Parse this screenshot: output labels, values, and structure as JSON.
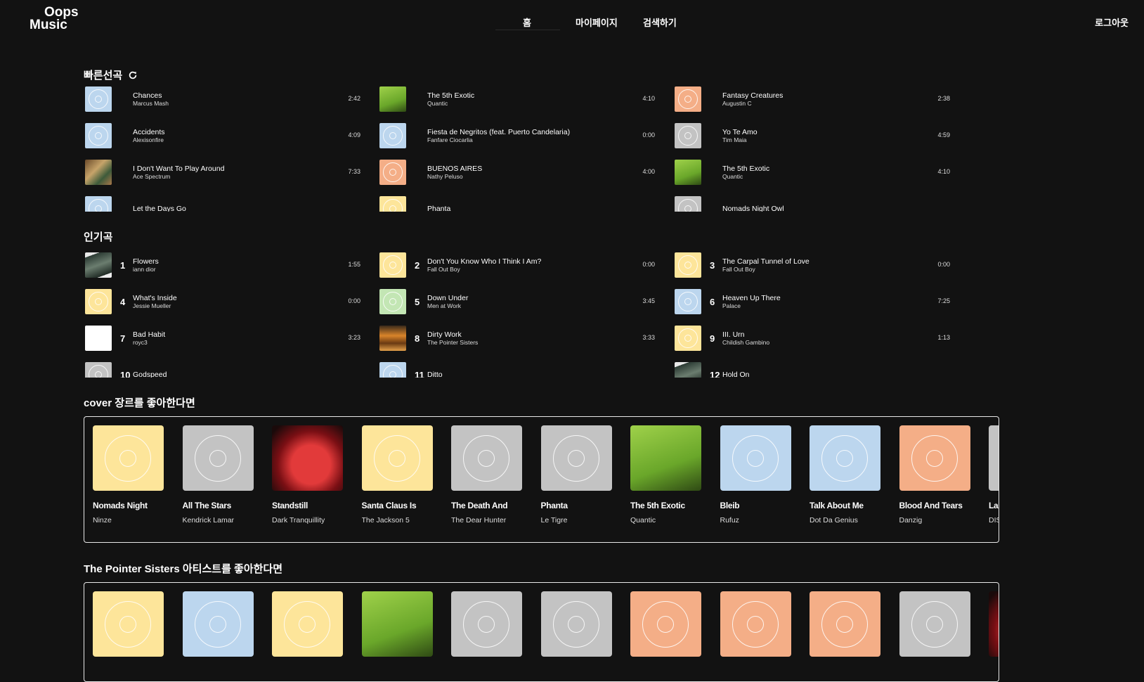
{
  "colors": {
    "blue": "#bcd6ee",
    "yellow": "#fde59a",
    "orange": "#f4ae87",
    "gray": "#c3c3c3",
    "green": "#c3e6b4",
    "lime": "#8fc43f",
    "white": "#ffffff",
    "bg": "#121212"
  },
  "header": {
    "logo_line1": "Oops",
    "logo_line2": "Music",
    "nav": [
      {
        "label": "홈"
      },
      {
        "label": "마이페이지"
      },
      {
        "label": "검색하기"
      }
    ],
    "logout": "로그아웃"
  },
  "quick": {
    "title": "빠른선곡",
    "columns": [
      [
        {
          "title": "Chances",
          "artist": "Marcus Mash",
          "duration": "2:42",
          "color": "blue"
        },
        {
          "title": "Accidents",
          "artist": "Alexisonfire",
          "duration": "4:09",
          "color": "blue"
        },
        {
          "title": "I Don't Want To Play Around",
          "artist": "Ace Spectrum",
          "duration": "7:33",
          "color": "photo-brown"
        },
        {
          "title": "Let the Days Go",
          "artist": "",
          "duration": "",
          "color": "blue"
        }
      ],
      [
        {
          "title": "The 5th Exotic",
          "artist": "Quantic",
          "duration": "4:10",
          "color": "lime"
        },
        {
          "title": "Fiesta de Negritos (feat. Puerto Candelaria)",
          "artist": "Fanfare Ciocarlia",
          "duration": "0:00",
          "color": "blue"
        },
        {
          "title": "BUENOS AIRES",
          "artist": "Nathy Peluso",
          "duration": "4:00",
          "color": "orange"
        },
        {
          "title": "Phanta",
          "artist": "",
          "duration": "",
          "color": "yellow"
        }
      ],
      [
        {
          "title": "Fantasy Creatures",
          "artist": "Augustin C",
          "duration": "2:38",
          "color": "orange"
        },
        {
          "title": "Yo Te Amo",
          "artist": "Tim Maia",
          "duration": "4:59",
          "color": "gray"
        },
        {
          "title": "The 5th Exotic",
          "artist": "Quantic",
          "duration": "4:10",
          "color": "lime"
        },
        {
          "title": "Nomads Night Owl",
          "artist": "",
          "duration": "",
          "color": "gray"
        }
      ]
    ]
  },
  "popular": {
    "title": "인기곡",
    "columns": [
      [
        {
          "rank": "1",
          "title": "Flowers",
          "artist": "iann dior",
          "duration": "1:55",
          "color": "photo-dark"
        },
        {
          "rank": "4",
          "title": "What's Inside",
          "artist": "Jessie Mueller",
          "duration": "0:00",
          "color": "yellow"
        },
        {
          "rank": "7",
          "title": "Bad Habit",
          "artist": "royc3",
          "duration": "3:23",
          "color": "white"
        },
        {
          "rank": "10",
          "title": "Godspeed",
          "artist": "",
          "duration": "",
          "color": "gray"
        }
      ],
      [
        {
          "rank": "2",
          "title": "Don't You Know Who I Think I Am?",
          "artist": "Fall Out Boy",
          "duration": "0:00",
          "color": "yellow"
        },
        {
          "rank": "5",
          "title": "Down Under",
          "artist": "Men at Work",
          "duration": "3:45",
          "color": "green"
        },
        {
          "rank": "8",
          "title": "Dirty Work",
          "artist": "The Pointer Sisters",
          "duration": "3:33",
          "color": "photo-orange"
        },
        {
          "rank": "11",
          "title": "Ditto",
          "artist": "",
          "duration": "",
          "color": "blue"
        }
      ],
      [
        {
          "rank": "3",
          "title": "The Carpal Tunnel of Love",
          "artist": "Fall Out Boy",
          "duration": "0:00",
          "color": "yellow"
        },
        {
          "rank": "6",
          "title": "Heaven Up There",
          "artist": "Palace",
          "duration": "7:25",
          "color": "blue"
        },
        {
          "rank": "9",
          "title": "III. Urn",
          "artist": "Childish Gambino",
          "duration": "1:13",
          "color": "yellow"
        },
        {
          "rank": "12",
          "title": "Hold On",
          "artist": "",
          "duration": "",
          "color": "photo-dark"
        }
      ]
    ]
  },
  "genre": {
    "title": "cover 장르를 좋아한다면",
    "cards": [
      {
        "title": "Nomads Night",
        "artist": "Ninze",
        "color": "yellow"
      },
      {
        "title": "All The Stars",
        "artist": "Kendrick Lamar",
        "color": "gray"
      },
      {
        "title": "Standstill",
        "artist": "Dark Tranquillity",
        "color": "photo-red"
      },
      {
        "title": "Santa Claus Is",
        "artist": "The Jackson 5",
        "color": "yellow"
      },
      {
        "title": "The Death And",
        "artist": "The Dear Hunter",
        "color": "gray"
      },
      {
        "title": "Phanta",
        "artist": "Le Tigre",
        "color": "gray"
      },
      {
        "title": "The 5th Exotic",
        "artist": "Quantic",
        "color": "lime"
      },
      {
        "title": "Bleib",
        "artist": "Rufuz",
        "color": "blue"
      },
      {
        "title": "Talk About Me",
        "artist": "Dot Da Genius",
        "color": "blue"
      },
      {
        "title": "Blood And Tears",
        "artist": "Danzig",
        "color": "orange"
      },
      {
        "title": "La",
        "artist": "DIS",
        "color": "gray"
      }
    ]
  },
  "artist": {
    "title": "The Pointer Sisters 아티스트를 좋아한다면",
    "cards": [
      {
        "color": "yellow"
      },
      {
        "color": "blue"
      },
      {
        "color": "yellow"
      },
      {
        "color": "lime"
      },
      {
        "color": "gray"
      },
      {
        "color": "gray"
      },
      {
        "color": "orange"
      },
      {
        "color": "orange"
      },
      {
        "color": "orange"
      },
      {
        "color": "gray"
      },
      {
        "color": "photo-red"
      }
    ]
  }
}
